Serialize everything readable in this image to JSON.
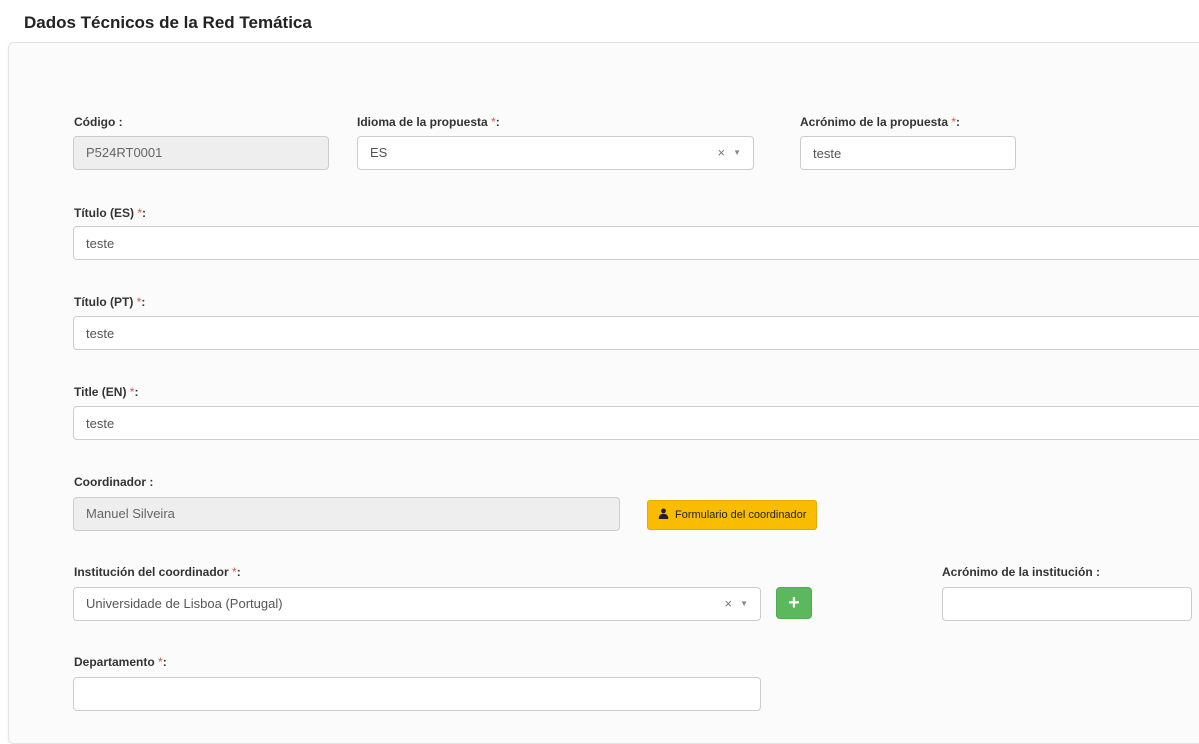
{
  "page": {
    "title": "Dados Técnicos de la Red Temática"
  },
  "form": {
    "codigo": {
      "label": "Código",
      "suffix": " :",
      "value": "P524RT0001"
    },
    "idioma": {
      "label": "Idioma de la propuesta",
      "required_mark": " *",
      "suffix": ":",
      "value": "ES"
    },
    "acronimo_propuesta": {
      "label": "Acrónimo de la propuesta",
      "required_mark": " *",
      "suffix": ":",
      "value": "teste"
    },
    "titulo_es": {
      "label": "Título (ES)",
      "required_mark": " *",
      "suffix": ":",
      "value": "teste"
    },
    "titulo_pt": {
      "label": "Título (PT)",
      "required_mark": " *",
      "suffix": ":",
      "value": "teste"
    },
    "title_en": {
      "label": "Title (EN)",
      "required_mark": " *",
      "suffix": ":",
      "value": "teste"
    },
    "coordinador": {
      "label": "Coordinador",
      "suffix": " :",
      "value": "Manuel Silveira",
      "button_label": "Formulario del coordinador"
    },
    "institucion": {
      "label": "Institución del coordinador",
      "required_mark": " *",
      "suffix": ":",
      "value": "Universidade de Lisboa (Portugal)",
      "add_button_label": "+"
    },
    "acronimo_institucion": {
      "label": "Acrónimo de la institución",
      "suffix": " :",
      "value": ""
    },
    "departamento": {
      "label": "Departamento",
      "required_mark": " *",
      "suffix": ":",
      "value": ""
    }
  },
  "icons": {
    "clear": "×",
    "caret": "▼",
    "user": "user-icon"
  },
  "colors": {
    "required": "#d9534f",
    "warning_button": "#f9bc00",
    "success_button": "#5cb85c"
  }
}
